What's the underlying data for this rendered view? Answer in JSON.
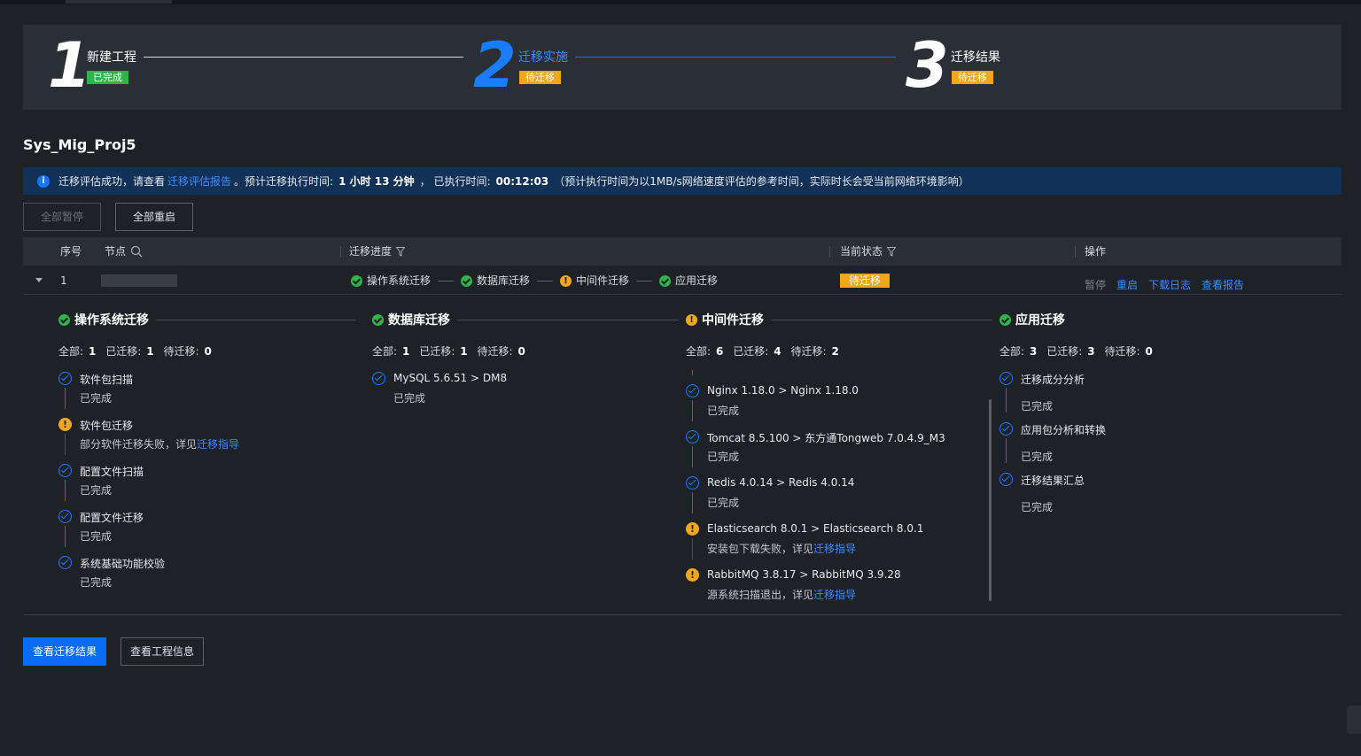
{
  "steps": [
    {
      "num": "1",
      "title": "新建工程",
      "badge": "已完成"
    },
    {
      "num": "2",
      "title": "迁移实施",
      "badge": "待迁移"
    },
    {
      "num": "3",
      "title": "迁移结果",
      "badge": "待迁移"
    }
  ],
  "project_title": "Sys_Mig_Proj5",
  "info": {
    "prefix": "迁移评估成功，请查看",
    "link": "迁移评估报告",
    "mid": "。预计迁移执行时间:",
    "estimate": "1 小时 13 分钟",
    "executed_label": "， 已执行时间:",
    "executed": "00:12:03",
    "note": "（预计执行时间为以1MB/s网络速度评估的参考时间，实际时长会受当前网络环境影响）"
  },
  "toolbar": {
    "pause_all": "全部暂停",
    "restart_all": "全部重启"
  },
  "table": {
    "headers": {
      "index": "序号",
      "node": "节点",
      "progress": "迁移进度",
      "status": "当前状态",
      "ops": "操作"
    },
    "row": {
      "index": "1",
      "progress": [
        "操作系统迁移",
        "数据库迁移",
        "中间件迁移",
        "应用迁移"
      ],
      "status": "待迁移",
      "ops": {
        "pause": "暂停",
        "restart": "重启",
        "download_log": "下载日志",
        "view_report": "查看报告"
      }
    }
  },
  "detail": {
    "os": {
      "title": "操作系统迁移",
      "stats": {
        "total_label": "全部:",
        "total": "1",
        "done_label": "已迁移:",
        "done": "1",
        "pending_label": "待迁移:",
        "pending": "0"
      },
      "items": [
        {
          "title": "软件包扫描",
          "sub": "已完成"
        },
        {
          "title": "软件包迁移",
          "sub": "部分软件迁移失败，详见",
          "link": "迁移指导"
        },
        {
          "title": "配置文件扫描",
          "sub": "已完成"
        },
        {
          "title": "配置文件迁移",
          "sub": "已完成"
        },
        {
          "title": "系统基础功能校验",
          "sub": "已完成"
        }
      ]
    },
    "db": {
      "title": "数据库迁移",
      "stats": {
        "total_label": "全部:",
        "total": "1",
        "done_label": "已迁移:",
        "done": "1",
        "pending_label": "待迁移:",
        "pending": "0"
      },
      "items": [
        {
          "title": "MySQL 5.6.51 > DM8",
          "sub": "已完成"
        }
      ]
    },
    "mw": {
      "title": "中间件迁移",
      "stats": {
        "total_label": "全部:",
        "total": "6",
        "done_label": "已迁移:",
        "done": "4",
        "pending_label": "待迁移:",
        "pending": "2"
      },
      "items": [
        {
          "title": "Nginx 1.18.0 > Nginx 1.18.0",
          "sub": "已完成"
        },
        {
          "title": "Tomcat 8.5.100 > 东方通Tongweb 7.0.4.9_M3",
          "sub": "已完成"
        },
        {
          "title": "Redis 4.0.14 > Redis 4.0.14",
          "sub": "已完成"
        },
        {
          "title": "Elasticsearch 8.0.1 > Elasticsearch 8.0.1",
          "sub": "安装包下载失败，详见",
          "link": "迁移指导"
        },
        {
          "title": "RabbitMQ 3.8.17 > RabbitMQ 3.9.28",
          "sub": "源系统扫描退出，详见",
          "link": "迁移指导"
        }
      ]
    },
    "app": {
      "title": "应用迁移",
      "stats": {
        "total_label": "全部:",
        "total": "3",
        "done_label": "已迁移:",
        "done": "3",
        "pending_label": "待迁移:",
        "pending": "0"
      },
      "items": [
        {
          "title": "迁移成分分析",
          "sub": "已完成"
        },
        {
          "title": "应用包分析和转换",
          "sub": "已完成"
        },
        {
          "title": "迁移结果汇总",
          "sub": "已完成"
        }
      ]
    }
  },
  "footer": {
    "view_result": "查看迁移结果",
    "view_project": "查看工程信息"
  },
  "colors": {
    "accent": "#0a6cf5",
    "success": "#2fb34a",
    "warning": "#f0a81a",
    "info_bg": "#123157"
  }
}
